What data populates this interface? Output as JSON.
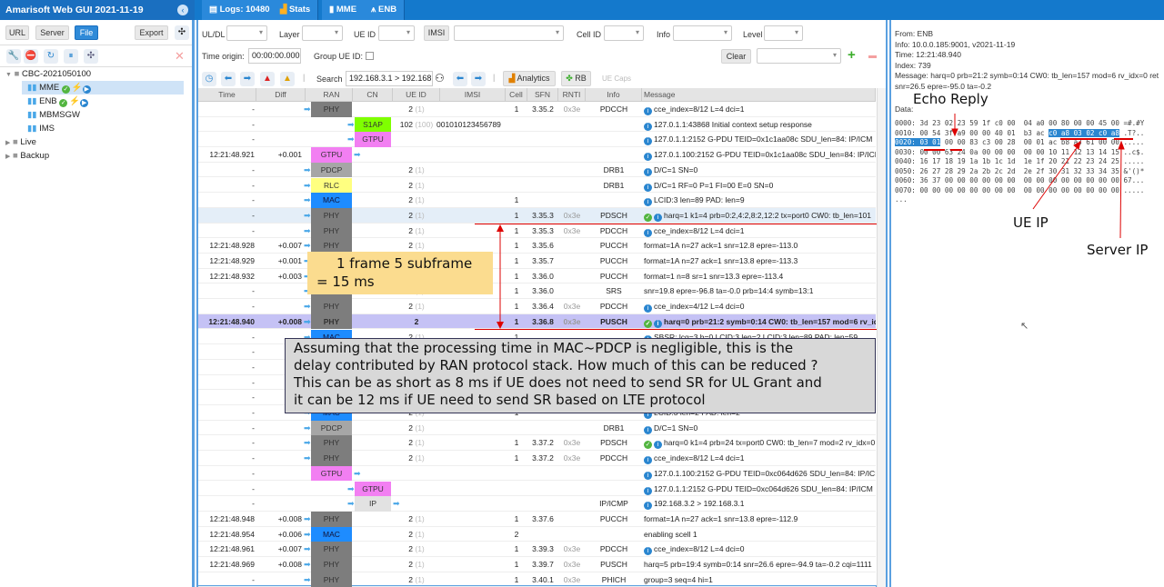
{
  "app": {
    "title": "Amarisoft Web GUI 2021-11-19"
  },
  "tabs": [
    {
      "label": "Logs: 10480",
      "icon": "document-icon"
    },
    {
      "label": "Stats",
      "icon": "bar-chart-icon"
    },
    {
      "label": "MME",
      "icon": "server-icon"
    },
    {
      "label": "ENB",
      "icon": "antenna-icon"
    }
  ],
  "sidebar": {
    "buttons": {
      "url": "URL",
      "server": "Server",
      "file": "File",
      "export": "Export"
    },
    "tree": [
      {
        "label": "CBC-2021050100",
        "level": 0,
        "type": "folder",
        "open": true
      },
      {
        "label": "MME",
        "level": 1,
        "status": true,
        "selected": true
      },
      {
        "label": "ENB",
        "level": 1,
        "status": true
      },
      {
        "label": "MBMSGW",
        "level": 1
      },
      {
        "label": "IMS",
        "level": 1
      },
      {
        "label": "Live",
        "level": 0,
        "type": "folder"
      },
      {
        "label": "Backup",
        "level": 0,
        "type": "folder"
      }
    ]
  },
  "filters": {
    "uldl": "UL/DL",
    "layer": "Layer",
    "ueid": "UE ID",
    "imsi": "IMSI",
    "cellid": "Cell ID",
    "info": "Info",
    "level": "Level",
    "time_origin_label": "Time origin:",
    "time_origin": "00:00:00.000",
    "group_ueid": "Group UE ID:",
    "clear": "Clear"
  },
  "toolbar": {
    "search_label": "Search",
    "search_value": "192.168.3.1 > 192.168.",
    "analytics": "Analytics",
    "rb": "RB",
    "uecaps": "UE Caps"
  },
  "columns": [
    "Time",
    "Diff",
    "RAN",
    "CN",
    "UE ID",
    "IMSI",
    "Cell",
    "SFN",
    "RNTI",
    "Info",
    "Message"
  ],
  "layer_colors": {
    "PHY": "#7d7d7d",
    "MAC": "#1e8cff",
    "RLC": "#ffff80",
    "PDCP": "#a6a6a6",
    "GTPU": "#f27ff2",
    "S1AP": "#7fff00",
    "IP": "#e2e2e2"
  },
  "rows": [
    {
      "time": "-",
      "ran": "PHY",
      "ue": "2",
      "ue2": "(1)",
      "cell": "1",
      "sfn": "3.35.2",
      "rnti": "0x3e",
      "info": "PDCCH",
      "icons": [
        "info"
      ],
      "msg": "cce_index=8/12 L=4 dci=1"
    },
    {
      "time": "-",
      "cn": "S1AP",
      "ue": "102",
      "ue2": "(100)",
      "imsi": "001010123456789",
      "icons": [
        "info"
      ],
      "msg": "127.0.1.1:43868 Initial context setup response"
    },
    {
      "time": "-",
      "cn": "GTPU",
      "icons": [
        "info"
      ],
      "msg": "127.0.1.1:2152 G-PDU TEID=0x1c1aa08c SDU_len=84: IP/ICM"
    },
    {
      "time": "12:21:48.921",
      "diff": "+0.001",
      "ran": "GTPU",
      "icons": [
        "info"
      ],
      "msg": "127.0.1.100:2152 G-PDU TEID=0x1c1aa08c SDU_len=84: IP/ICM"
    },
    {
      "time": "-",
      "ran": "PDCP",
      "ue": "2",
      "ue2": "(1)",
      "info": "DRB1",
      "icons": [
        "info"
      ],
      "msg": "D/C=1 SN=0"
    },
    {
      "time": "-",
      "ran": "RLC",
      "ue": "2",
      "ue2": "(1)",
      "info": "DRB1",
      "icons": [
        "info"
      ],
      "msg": "D/C=1 RF=0 P=1 FI=00 E=0 SN=0"
    },
    {
      "time": "-",
      "ran": "MAC",
      "ue": "2",
      "ue2": "(1)",
      "cell": "1",
      "icons": [
        "info"
      ],
      "msg": "LCID:3 len=89 PAD: len=9"
    },
    {
      "time": "-",
      "ran": "PHY",
      "ue": "2",
      "ue2": "(1)",
      "cell": "1",
      "sfn": "3.35.3",
      "rnti": "0x3e",
      "info": "PDSCH",
      "icons": [
        "chk",
        "info"
      ],
      "msg": "harq=1 k1=4 prb=0:2,4:2,8:2,12:2 tx=port0 CW0: tb_len=101",
      "state": "hover"
    },
    {
      "time": "-",
      "ran": "PHY",
      "ue": "2",
      "ue2": "(1)",
      "cell": "1",
      "sfn": "3.35.3",
      "rnti": "0x3e",
      "info": "PDCCH",
      "icons": [
        "info"
      ],
      "msg": "cce_index=8/12 L=4 dci=1"
    },
    {
      "time": "12:21:48.928",
      "diff": "+0.007",
      "ran": "PHY",
      "ue": "2",
      "ue2": "(1)",
      "cell": "1",
      "sfn": "3.35.6",
      "info": "PUCCH",
      "msg": "format=1A n=27 ack=1 snr=12.8 epre=-113.0"
    },
    {
      "time": "12:21:48.929",
      "diff": "+0.001",
      "ran": "PHY",
      "ue": "2",
      "ue2": "(1)",
      "cell": "1",
      "sfn": "3.35.7",
      "info": "PUCCH",
      "msg": "format=1A n=27 ack=1 snr=13.8 epre=-113.3"
    },
    {
      "time": "12:21:48.932",
      "diff": "+0.003",
      "ran": "PHY",
      "ue": "2",
      "ue2": "(1)",
      "cell": "1",
      "sfn": "3.36.0",
      "info": "PUCCH",
      "msg": "format=1 n=8 sr=1 snr=13.3 epre=-113.4"
    },
    {
      "time": "-",
      "ran": "PHY",
      "ue": "2",
      "ue2": "(1)",
      "cell": "1",
      "sfn": "3.36.0",
      "info": "SRS",
      "msg": "snr=19.8 epre=-96.8 ta=-0.0 prb=14:4 symb=13:1"
    },
    {
      "time": "-",
      "ran": "PHY",
      "ue": "2",
      "ue2": "(1)",
      "cell": "1",
      "sfn": "3.36.4",
      "rnti": "0x3e",
      "info": "PDCCH",
      "icons": [
        "info"
      ],
      "msg": "cce_index=4/12 L=4 dci=0"
    },
    {
      "time": "12:21:48.940",
      "diff": "+0.008",
      "ran": "PHY",
      "ue": "2",
      "cell": "1",
      "sfn": "3.36.8",
      "rnti": "0x3e",
      "info": "PUSCH",
      "icons": [
        "chk",
        "info"
      ],
      "msg": "harq=0 prb=21:2 symb=0:14 CW0: tb_len=157 mod=6 rv_idx=0",
      "state": "selected"
    },
    {
      "time": "-",
      "ran": "MAC",
      "ue": "2",
      "ue2": "(1)",
      "cell": "1",
      "icons": [
        "info"
      ],
      "msg": "SBSR: lcg=3 b=0 LCID:3 len=2 LCID:3 len=89 PAD: len=59"
    },
    {
      "time": "-"
    },
    {
      "time": "-"
    },
    {
      "time": "-"
    },
    {
      "time": "-"
    },
    {
      "time": "-",
      "ran": "MAC",
      "ue": "2",
      "ue2": "(1)",
      "cell": "1",
      "icons": [
        "info"
      ],
      "msg": "LCID:3 len=2 PAD: len=2"
    },
    {
      "time": "-",
      "ran": "PDCP",
      "ue": "2",
      "ue2": "(1)",
      "info": "DRB1",
      "icons": [
        "info"
      ],
      "msg": "D/C=1 SN=0"
    },
    {
      "time": "-",
      "ran": "PHY",
      "ue": "2",
      "ue2": "(1)",
      "cell": "1",
      "sfn": "3.37.2",
      "rnti": "0x3e",
      "info": "PDSCH",
      "icons": [
        "chk",
        "info"
      ],
      "msg": "harq=0 k1=4 prb=24 tx=port0 CW0: tb_len=7 mod=2 rv_idx=0"
    },
    {
      "time": "-",
      "ran": "PHY",
      "ue": "2",
      "ue2": "(1)",
      "cell": "1",
      "sfn": "3.37.2",
      "rnti": "0x3e",
      "info": "PDCCH",
      "icons": [
        "info"
      ],
      "msg": "cce_index=8/12 L=4 dci=1"
    },
    {
      "time": "-",
      "ran": "GTPU",
      "icons": [
        "info"
      ],
      "msg": "127.0.1.100:2152 G-PDU TEID=0xc064d626 SDU_len=84: IP/ICM"
    },
    {
      "time": "-",
      "cn": "GTPU",
      "icons": [
        "info"
      ],
      "msg": "127.0.1.1:2152 G-PDU TEID=0xc064d626 SDU_len=84: IP/ICM"
    },
    {
      "time": "-",
      "cn": "IP",
      "info": "IP/ICMP",
      "icons": [
        "info"
      ],
      "msg": "192.168.3.2 > 192.168.3.1"
    },
    {
      "time": "12:21:48.948",
      "diff": "+0.008",
      "ran": "PHY",
      "ue": "2",
      "ue2": "(1)",
      "cell": "1",
      "sfn": "3.37.6",
      "info": "PUCCH",
      "msg": "format=1A n=27 ack=1 snr=13.8 epre=-112.9"
    },
    {
      "time": "12:21:48.954",
      "diff": "+0.006",
      "ran": "MAC",
      "ue": "2",
      "ue2": "(1)",
      "cell": "2",
      "msg": "enabling scell 1"
    },
    {
      "time": "12:21:48.961",
      "diff": "+0.007",
      "ran": "PHY",
      "ue": "2",
      "ue2": "(1)",
      "cell": "1",
      "sfn": "3.39.3",
      "rnti": "0x3e",
      "info": "PDCCH",
      "icons": [
        "info"
      ],
      "msg": "cce_index=8/12 L=4 dci=0"
    },
    {
      "time": "12:21:48.969",
      "diff": "+0.008",
      "ran": "PHY",
      "ue": "2",
      "ue2": "(1)",
      "cell": "1",
      "sfn": "3.39.7",
      "rnti": "0x3e",
      "info": "PUSCH",
      "msg": "harq=5 prb=19:4 symb=0:14 snr=26.6 epre=-94.9 ta=-0.2 cqi=1111"
    },
    {
      "time": "-",
      "ran": "PHY",
      "ue": "2",
      "ue2": "(1)",
      "cell": "1",
      "sfn": "3.40.1",
      "rnti": "0x3e",
      "info": "PHICH",
      "msg": "group=3 seq=4 hi=1"
    }
  ],
  "detail": {
    "from": "From: ENB",
    "info": "Info: 10.0.0.185:9001, v2021-11-19",
    "time": "Time: 12:21:48.940",
    "index": "Index: 739",
    "message": "Message: harq=0 prb=21:2 symb=0:14 CW0: tb_len=157 mod=6 rv_idx=0 ret",
    "message2": "snr=26.5 epre=-95.0 ta=-0.2",
    "data_label": "Data:",
    "hex": [
      [
        "0000:",
        "3d 23 02 23 59 1f c0 00  04 a0 00 80 00 00 45 00",
        "=#.#Y"
      ],
      [
        "0010:",
        "00 54 3f a9 00 00 40 01  b3 ac ",
        "c0 a8 03 02 c0 a8",
        ".T?.."
      ],
      [
        "0020:",
        "03 01",
        " 00 00 83 c3 00 28  00 01 ac b8 a3 61 00 00",
        "....."
      ],
      [
        "0030:",
        "00 00 63 24 0a 00 00 00  00 00 10 11 12 13 14 15",
        "..c$."
      ],
      [
        "0040:",
        "16 17 18 19 1a 1b 1c 1d  1e 1f 20 21 22 23 24 25",
        "....."
      ],
      [
        "0050:",
        "26 27 28 29 2a 2b 2c 2d  2e 2f 30 31 32 33 34 35",
        "&'()*"
      ],
      [
        "0060:",
        "36 37 00 00 00 00 00 00  00 00 00 00 00 00 00 00",
        "67..."
      ],
      [
        "0070:",
        "00 00 00 00 00 00 00 00  00 00 00 00 00 00 00 00",
        "....."
      ]
    ],
    "ellipsis": "..."
  },
  "annotations": {
    "frame_note": "1 frame 5 subframe",
    "frame_note2": "= 15 ms",
    "callout": [
      "Assuming that the processing time in MAC~PDCP is negligible, this is the",
      "delay contributed by RAN protocol stack. How much of this can be reduced ?",
      "This can be as short as 8 ms if UE does not need to send SR for UL Grant and",
      "it can be 12 ms if UE need to send SR based on LTE protocol"
    ],
    "echo_reply": "Echo Reply",
    "ue_ip": "UE IP",
    "server_ip": "Server IP"
  }
}
